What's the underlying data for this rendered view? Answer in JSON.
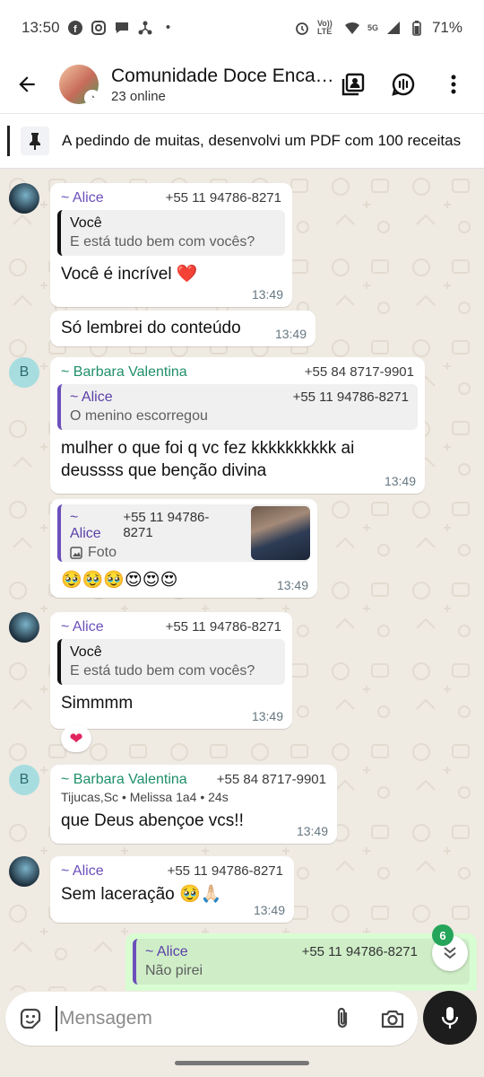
{
  "status": {
    "time": "13:50",
    "battery": "71%",
    "volte": "Vo)) LTE",
    "network": "5G"
  },
  "header": {
    "title": "Comunidade Doce Encantos",
    "subtitle": "23 online"
  },
  "pinned": {
    "text": "A pedindo de muitas, desenvolvi um PDF com 100 receitas"
  },
  "messages": [
    {
      "sender": "~ Alice",
      "phone": "+55 11 94786-8271",
      "quote_name": "Você",
      "quote_text": "E está tudo bem com vocês?",
      "text": "Você é incrível ❤️",
      "time": "13:49"
    },
    {
      "text": "Só lembrei do conteúdo",
      "time": "13:49"
    },
    {
      "sender": "~ Barbara Valentina",
      "phone": "+55 84 8717-9901",
      "avatar_letter": "B",
      "quote_name": "~ Alice",
      "quote_phone": "+55 11 94786-8271",
      "quote_text": "O menino escorregou",
      "text": "mulher o que foi q vc fez kkkkkkkkkk ai deussss que benção divina",
      "time": "13:49"
    },
    {
      "quote_name": "~ Alice",
      "quote_phone": "+55 11 94786-8271",
      "quote_text": "Foto",
      "text": "🥹🥹🥹😍😍😍",
      "time": "13:49"
    },
    {
      "sender": "~ Alice",
      "phone": "+55 11 94786-8271",
      "quote_name": "Você",
      "quote_text": "E está tudo bem com vocês?",
      "text": "Simmmm",
      "time": "13:49",
      "reaction": "❤"
    },
    {
      "sender": "~ Barbara Valentina",
      "phone": "+55 84 8717-9901",
      "avatar_letter": "B",
      "meta": "Tijucas,Sc • Melissa 1a4 • 24s",
      "text": "que Deus abençoe vcs!!",
      "time": "13:49"
    },
    {
      "sender": "~ Alice",
      "phone": "+55 11 94786-8271",
      "text": "Sem laceração 🥹🙏🏻",
      "time": "13:49"
    },
    {
      "quote_name": "~ Alice",
      "quote_phone": "+55 11 94786-8271",
      "quote_text": "Não pirei"
    }
  ],
  "scroll": {
    "unread": "6"
  },
  "composer": {
    "placeholder": "Mensagem"
  }
}
